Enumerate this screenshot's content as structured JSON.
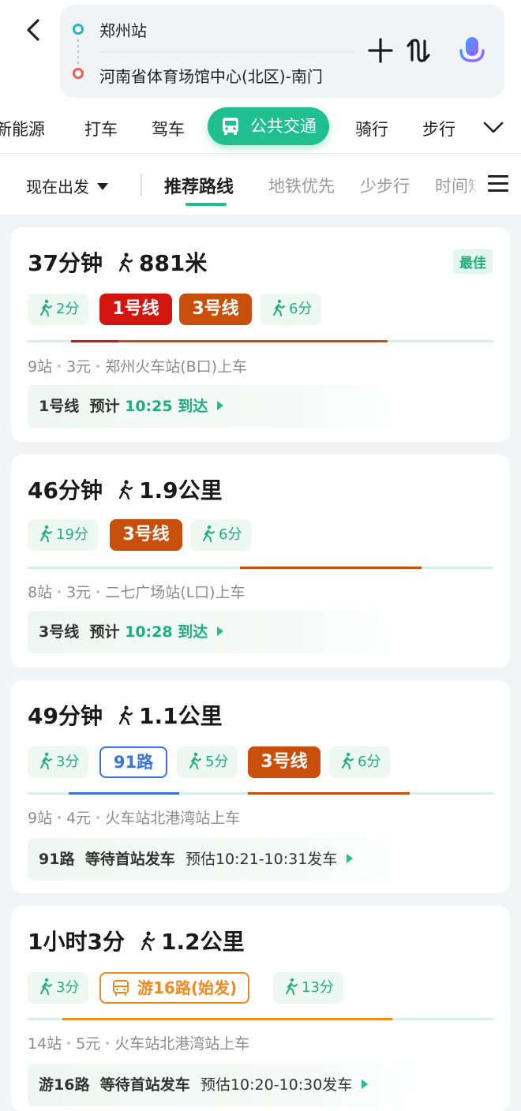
{
  "search": {
    "from": "郑州站",
    "to": "河南省体育场馆中心(北区)-南门"
  },
  "modes": [
    "新能源",
    "打车",
    "驾车",
    "公共交通",
    "骑行",
    "步行"
  ],
  "active_mode": "公共交通",
  "depart_label": "现在出发",
  "sort_tabs": [
    "推荐路线",
    "地铁优先",
    "少步行",
    "时间短"
  ],
  "colors": {
    "accent": "#1fbf8f",
    "line1": "#d0160f",
    "line3": "#c9500c",
    "bus91": "#3b73d6",
    "tour16": "#f08a1e"
  },
  "routes": [
    {
      "time": "37分钟",
      "walk": "881米",
      "badge": "最佳",
      "segments": [
        {
          "type": "walk",
          "label": "2分"
        },
        {
          "type": "subway",
          "label": "1号线"
        },
        {
          "type": "subway",
          "label": "3号线"
        },
        {
          "type": "walk",
          "label": "6分"
        }
      ],
      "stops": "9站",
      "fare": "3元",
      "board": "郑州火车站(B口)上车",
      "arrival_line": "1号线",
      "arrival_prefix": "预计",
      "arrival_time": "10:25",
      "arrival_suffix": "到达"
    },
    {
      "time": "46分钟",
      "walk": "1.9公里",
      "segments": [
        {
          "type": "walk",
          "label": "19分"
        },
        {
          "type": "subway",
          "label": "3号线"
        },
        {
          "type": "walk",
          "label": "6分"
        }
      ],
      "stops": "8站",
      "fare": "3元",
      "board": "二七广场站(L口)上车",
      "arrival_line": "3号线",
      "arrival_prefix": "预计",
      "arrival_time": "10:28",
      "arrival_suffix": "到达"
    },
    {
      "time": "49分钟",
      "walk": "1.1公里",
      "segments": [
        {
          "type": "walk",
          "label": "3分"
        },
        {
          "type": "bus",
          "label": "91路"
        },
        {
          "type": "walk",
          "label": "5分"
        },
        {
          "type": "subway",
          "label": "3号线"
        },
        {
          "type": "walk",
          "label": "6分"
        }
      ],
      "stops": "9站",
      "fare": "4元",
      "board": "火车站北港湾站上车",
      "arrival_line": "91路",
      "arrival_status": "等待首站发车",
      "arrival_estimate": "预估10:21-10:31发车"
    },
    {
      "time": "1小时3分",
      "walk": "1.2公里",
      "segments": [
        {
          "type": "walk",
          "label": "3分"
        },
        {
          "type": "tour-bus",
          "label": "游16路(始发)"
        },
        {
          "type": "walk",
          "label": "13分"
        }
      ],
      "stops": "14站",
      "fare": "5元",
      "board": "火车站北港湾站上车",
      "arrival_line": "游16路",
      "arrival_status": "等待首站发车",
      "arrival_estimate": "预估10:20-10:30发车"
    }
  ]
}
